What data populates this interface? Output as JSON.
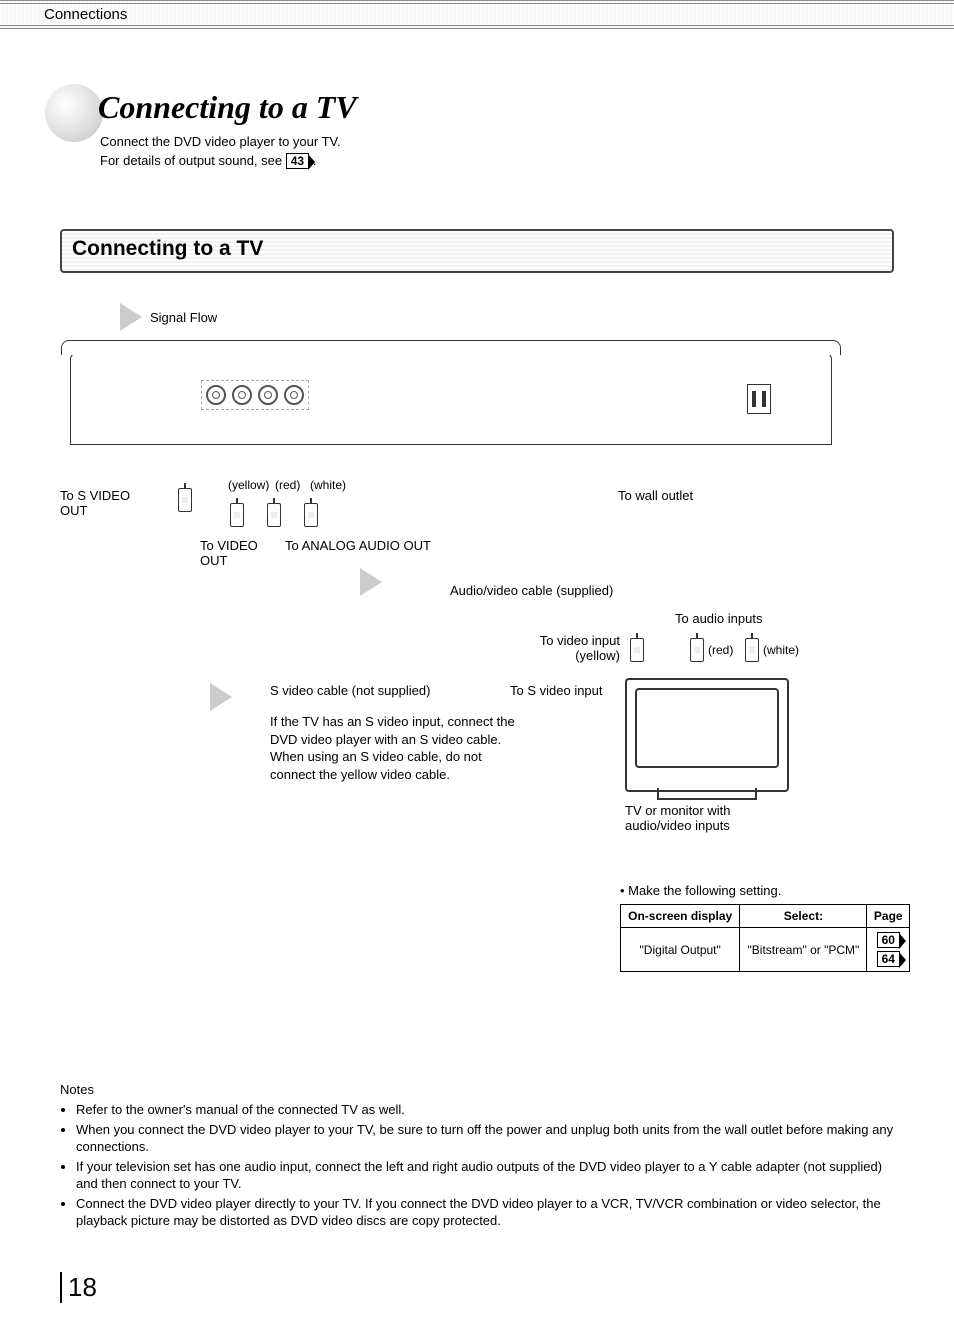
{
  "header_tab": "Connections",
  "title": "Connecting to a TV",
  "intro1": "Connect the DVD video player to your TV.",
  "intro2_a": "For details of output sound, see ",
  "intro2_ref": "43",
  "intro2_b": ".",
  "section_heading": "Connecting to a TV",
  "signal_flow": "Signal Flow",
  "labels": {
    "svideo_out": "To S VIDEO OUT",
    "yellow": "(yellow)",
    "red": "(red)",
    "white": "(white)",
    "wall": "To wall outlet",
    "video_out": "To VIDEO OUT",
    "analog_audio": "To ANALOG AUDIO OUT",
    "av_cable": "Audio/video cable (supplied)",
    "audio_inputs": "To audio inputs",
    "video_input_a": "To video input",
    "video_input_b": "(yellow)",
    "svideo_cable": "S video cable (not supplied)",
    "svideo_input": "To S video input",
    "svideo_note": "If the TV has an S video input, connect the DVD video player with an S video cable. When using an S video cable, do not connect the yellow video cable.",
    "tv_caption": "TV or monitor with audio/video inputs"
  },
  "settings_intro": "Make the following setting.",
  "settings_table": {
    "h1": "On-screen display",
    "h2": "Select:",
    "h3": "Page",
    "r1c1": "\"Digital Output\"",
    "r1c2": "\"Bitstream\" or \"PCM\"",
    "r1c3a": "60",
    "r1c3b": "64"
  },
  "notes_heading": "Notes",
  "notes": [
    "Refer to the owner's manual of the connected TV as well.",
    "When you connect the DVD video player to your TV, be sure to turn off the power and unplug both units from the wall outlet before making any connections.",
    "If your television set has one audio input, connect the left and right audio outputs of the DVD video player to a Y cable adapter (not supplied) and then connect to your TV.",
    "Connect the DVD video player directly to your TV. If you connect the DVD video player to a VCR, TV/VCR combination or video selector, the playback picture may be distorted as DVD video discs are copy protected."
  ],
  "page_number": "18"
}
